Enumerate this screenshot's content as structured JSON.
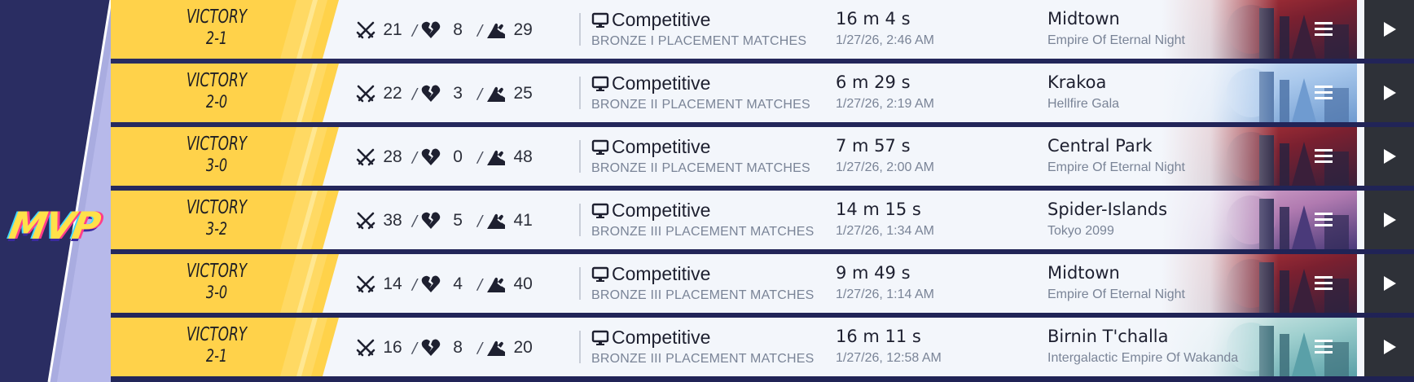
{
  "logo": {
    "text": "MVP"
  },
  "matches": [
    {
      "result": "VICTORY",
      "score": "2-1",
      "kills": "21",
      "deaths": "8",
      "assists": "29",
      "mode": "Competitive",
      "rank": "BRONZE I PLACEMENT MATCHES",
      "duration": "16 m 4 s",
      "date": "1/27/26, 2:46 AM",
      "map": "Midtown",
      "location": "Empire Of Eternal Night",
      "theme": "red"
    },
    {
      "result": "VICTORY",
      "score": "2-0",
      "kills": "22",
      "deaths": "3",
      "assists": "25",
      "mode": "Competitive",
      "rank": "BRONZE II PLACEMENT MATCHES",
      "duration": "6 m 29 s",
      "date": "1/27/26, 2:19 AM",
      "map": "Krakoa",
      "location": "Hellfire Gala",
      "theme": "blue"
    },
    {
      "result": "VICTORY",
      "score": "3-0",
      "kills": "28",
      "deaths": "0",
      "assists": "48",
      "mode": "Competitive",
      "rank": "BRONZE II PLACEMENT MATCHES",
      "duration": "7 m 57 s",
      "date": "1/27/26, 2:00 AM",
      "map": "Central Park",
      "location": "Empire Of Eternal Night",
      "theme": "red"
    },
    {
      "result": "VICTORY",
      "score": "3-2",
      "kills": "38",
      "deaths": "5",
      "assists": "41",
      "mode": "Competitive",
      "rank": "BRONZE III PLACEMENT MATCHES",
      "duration": "14 m 15 s",
      "date": "1/27/26, 1:34 AM",
      "map": "Spider-Islands",
      "location": "Tokyo 2099",
      "theme": "purple"
    },
    {
      "result": "VICTORY",
      "score": "3-0",
      "kills": "14",
      "deaths": "4",
      "assists": "40",
      "mode": "Competitive",
      "rank": "BRONZE III PLACEMENT MATCHES",
      "duration": "9 m 49 s",
      "date": "1/27/26, 1:14 AM",
      "map": "Midtown",
      "location": "Empire Of Eternal Night",
      "theme": "red"
    },
    {
      "result": "VICTORY",
      "score": "2-1",
      "kills": "16",
      "deaths": "8",
      "assists": "20",
      "mode": "Competitive",
      "rank": "BRONZE III PLACEMENT MATCHES",
      "duration": "16 m 11 s",
      "date": "1/27/26, 12:58 AM",
      "map": "Birnin T'challa",
      "location": "Intergalactic Empire Of Wakanda",
      "theme": "teal"
    }
  ],
  "icons": {
    "kills": "crossed-swords-icon",
    "deaths": "broken-heart-icon",
    "assists": "helping-hand-icon",
    "mode": "monitor-icon",
    "menu": "menu-icon",
    "play": "play-icon"
  },
  "colors": {
    "victory": "#ffd24a",
    "row_bg": "#f3f6fb",
    "accent_panel": "#9aa0d8",
    "play_bg": "#2e3138"
  }
}
